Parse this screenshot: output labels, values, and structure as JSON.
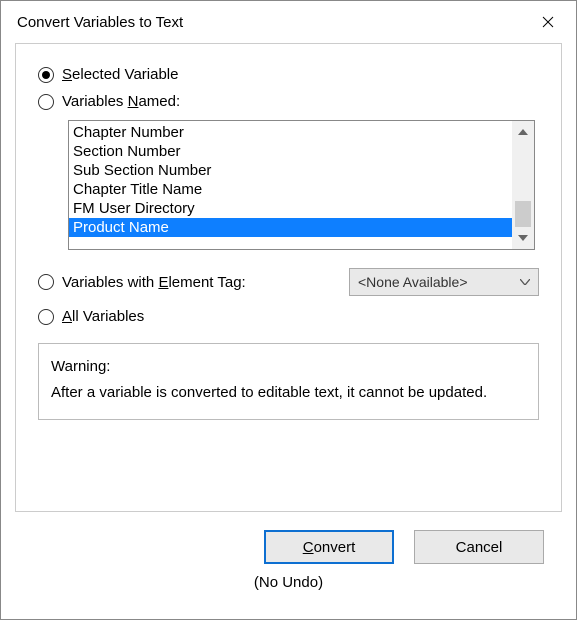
{
  "window": {
    "title": "Convert Variables to Text"
  },
  "options": {
    "selected_variable": {
      "label_pre": "",
      "mne": "S",
      "label_post": "elected Variable",
      "checked": true
    },
    "variables_named": {
      "label_pre": "Variables ",
      "mne": "N",
      "label_post": "amed:",
      "checked": false
    },
    "with_element_tag": {
      "label_pre": "Variables with ",
      "mne": "E",
      "label_post": "lement Tag:",
      "checked": false
    },
    "all_variables": {
      "label_pre": "",
      "mne": "A",
      "label_post": "ll Variables",
      "checked": false
    }
  },
  "listbox": {
    "items": [
      {
        "label": "Chapter Number",
        "selected": false
      },
      {
        "label": "Section Number",
        "selected": false
      },
      {
        "label": "Sub Section Number",
        "selected": false
      },
      {
        "label": "Chapter Title Name",
        "selected": false
      },
      {
        "label": "FM User Directory",
        "selected": false
      },
      {
        "label": "Product Name",
        "selected": true
      }
    ]
  },
  "element_tag_dropdown": {
    "value": "<None Available>"
  },
  "warning": {
    "heading": "Warning:",
    "body": "After a variable is converted to editable text, it cannot be updated."
  },
  "buttons": {
    "convert_mne": "C",
    "convert_post": "onvert",
    "cancel": "Cancel"
  },
  "footer": {
    "no_undo": "(No Undo)"
  }
}
